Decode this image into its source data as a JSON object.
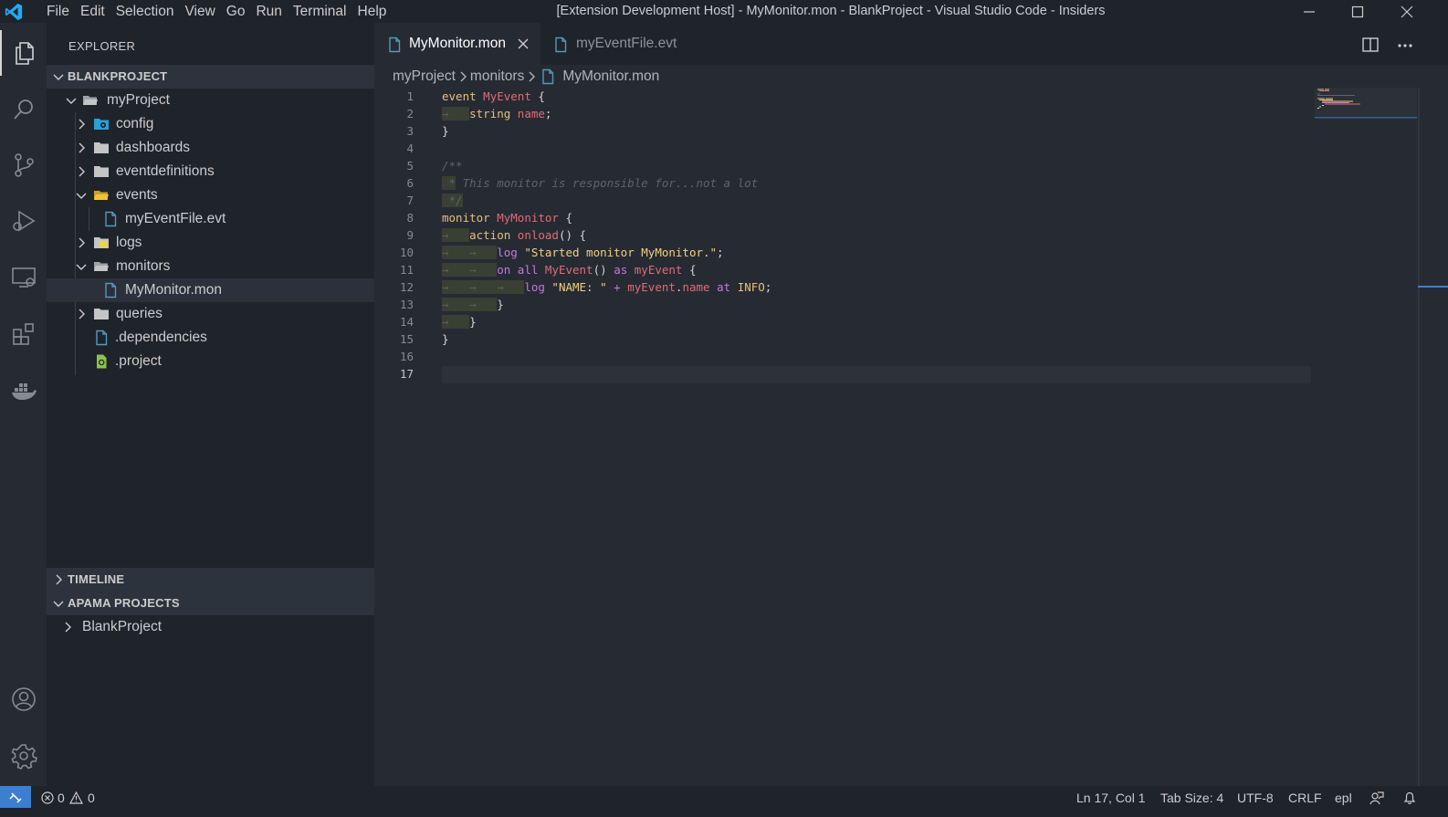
{
  "titlebar": {
    "menu": [
      "File",
      "Edit",
      "Selection",
      "View",
      "Go",
      "Run",
      "Terminal",
      "Help"
    ],
    "window_title": "[Extension Development Host] - MyMonitor.mon - BlankProject - Visual Studio Code - Insiders"
  },
  "sidebar": {
    "title": "EXPLORER",
    "workspace": "BLANKPROJECT",
    "tree": [
      {
        "label": "myProject",
        "type": "folder-open"
      },
      {
        "label": "config",
        "type": "folder-config"
      },
      {
        "label": "dashboards",
        "type": "folder"
      },
      {
        "label": "eventdefinitions",
        "type": "folder"
      },
      {
        "label": "events",
        "type": "folder-open-events"
      },
      {
        "label": "myEventFile.evt",
        "type": "file"
      },
      {
        "label": "logs",
        "type": "folder-logs"
      },
      {
        "label": "monitors",
        "type": "folder-open"
      },
      {
        "label": "MyMonitor.mon",
        "type": "file"
      },
      {
        "label": "queries",
        "type": "folder"
      },
      {
        "label": ".dependencies",
        "type": "file"
      },
      {
        "label": ".project",
        "type": "file-project"
      }
    ],
    "timeline": "TIMELINE",
    "apama": "APAMA PROJECTS",
    "apama_item": "BlankProject"
  },
  "tabs": [
    {
      "label": "MyMonitor.mon",
      "active": true
    },
    {
      "label": "myEventFile.evt",
      "active": false
    }
  ],
  "breadcrumb": [
    "myProject",
    "monitors",
    "MyMonitor.mon"
  ],
  "editor": {
    "line_numbers": [
      "1",
      "2",
      "3",
      "4",
      "5",
      "6",
      "7",
      "8",
      "9",
      "10",
      "11",
      "12",
      "13",
      "14",
      "15",
      "16",
      "17"
    ]
  },
  "status": {
    "errors": "0",
    "warnings": "0",
    "position": "Ln 17, Col 1",
    "tab_size": "Tab Size: 4",
    "encoding": "UTF-8",
    "eol": "CRLF",
    "language": "epl"
  },
  "colors": {
    "accent": "#3c7fd0",
    "file_icon": "#519aba",
    "folder_icon": "#c5c5c5",
    "project_icon": "#8bc34a"
  }
}
